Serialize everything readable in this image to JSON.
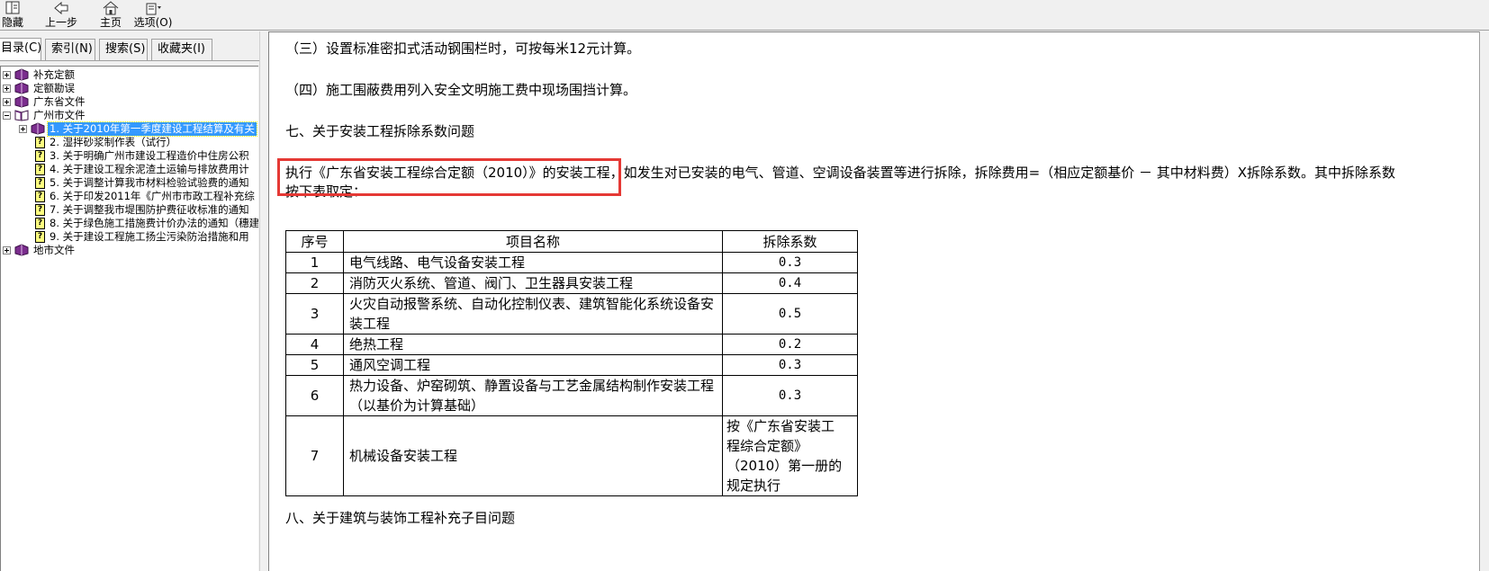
{
  "toolbar": {
    "hide_label": "隐藏",
    "back_label": "上一步",
    "home_label": "主页",
    "options_label": "选项(O)"
  },
  "tabs": [
    "目录(C)",
    "索引(N)",
    "搜索(S)",
    "收藏夹(I)"
  ],
  "tree": {
    "top_nodes": [
      "补充定额",
      "定额勘误",
      "广东省文件",
      "广州市文件"
    ],
    "guangzhou_children": [
      "1. 关于2010年第一季度建设工程结算及有关",
      "2. 湿拌砂浆制作表（试行）",
      "3. 关于明确广州市建设工程造价中住房公积",
      "4. 关于建设工程余泥渣土运输与排放费用计",
      "5. 关于调整计算我市材料检验试验费的通知",
      "6. 关于印发2011年《广州市市政工程补充综",
      "7. 关于调整我市堤围防护费征收标准的通知",
      "8. 关于绿色施工措施费计价办法的通知（穗建",
      "9. 关于建设工程施工扬尘污染防治措施和用"
    ],
    "last_node": "地市文件"
  },
  "content": {
    "p1": "（三）设置标准密扣式活动钢围栏时，可按每米12元计算。",
    "p2": "（四）施工围蔽费用列入安全文明施工费中现场围挡计算。",
    "h7": "七、关于安装工程拆除系数问题",
    "p3_line1": "执行《广东省安装工程综合定额（2010）》的安装工程，如发生对已安装的电气、管道、空调设备装置等进行拆除，拆除费用=（相应定额基价 － 其中材料费）X拆除系数。其中拆除系数",
    "p3_line2": "按下表取定：",
    "h8": "八、关于建筑与装饰工程补充子目问题"
  },
  "table": {
    "headers": [
      "序号",
      "项目名称",
      "拆除系数"
    ],
    "rows": [
      {
        "no": "1",
        "name_lines": [
          "电气线路、电气设备安装工程"
        ],
        "coef_lines": [
          "0.3"
        ]
      },
      {
        "no": "2",
        "name_lines": [
          "消防灭火系统、管道、阀门、卫生器具安装工程"
        ],
        "coef_lines": [
          "0.4"
        ]
      },
      {
        "no": "3",
        "name_lines": [
          "火灾自动报警系统、自动化控制仪表、建筑智能化系统设备安",
          "装工程"
        ],
        "coef_lines": [
          "0.5"
        ]
      },
      {
        "no": "4",
        "name_lines": [
          "绝热工程"
        ],
        "coef_lines": [
          "0.2"
        ]
      },
      {
        "no": "5",
        "name_lines": [
          "通风空调工程"
        ],
        "coef_lines": [
          "0.3"
        ]
      },
      {
        "no": "6",
        "name_lines": [
          "热力设备、炉窑砌筑、静置设备与工艺金属结构制作安装工程",
          "（以基价为计算基础）"
        ],
        "coef_lines": [
          "0.3"
        ]
      },
      {
        "no": "7",
        "name_lines": [
          "机械设备安装工程"
        ],
        "coef_lines": [
          "按《广东省安装工",
          "程综合定额》",
          "（2010）第一册的",
          "规定执行"
        ]
      }
    ]
  },
  "colors": {
    "highlight": "#e53935",
    "selection": "#3399ff",
    "book": "#7b2d8e"
  }
}
